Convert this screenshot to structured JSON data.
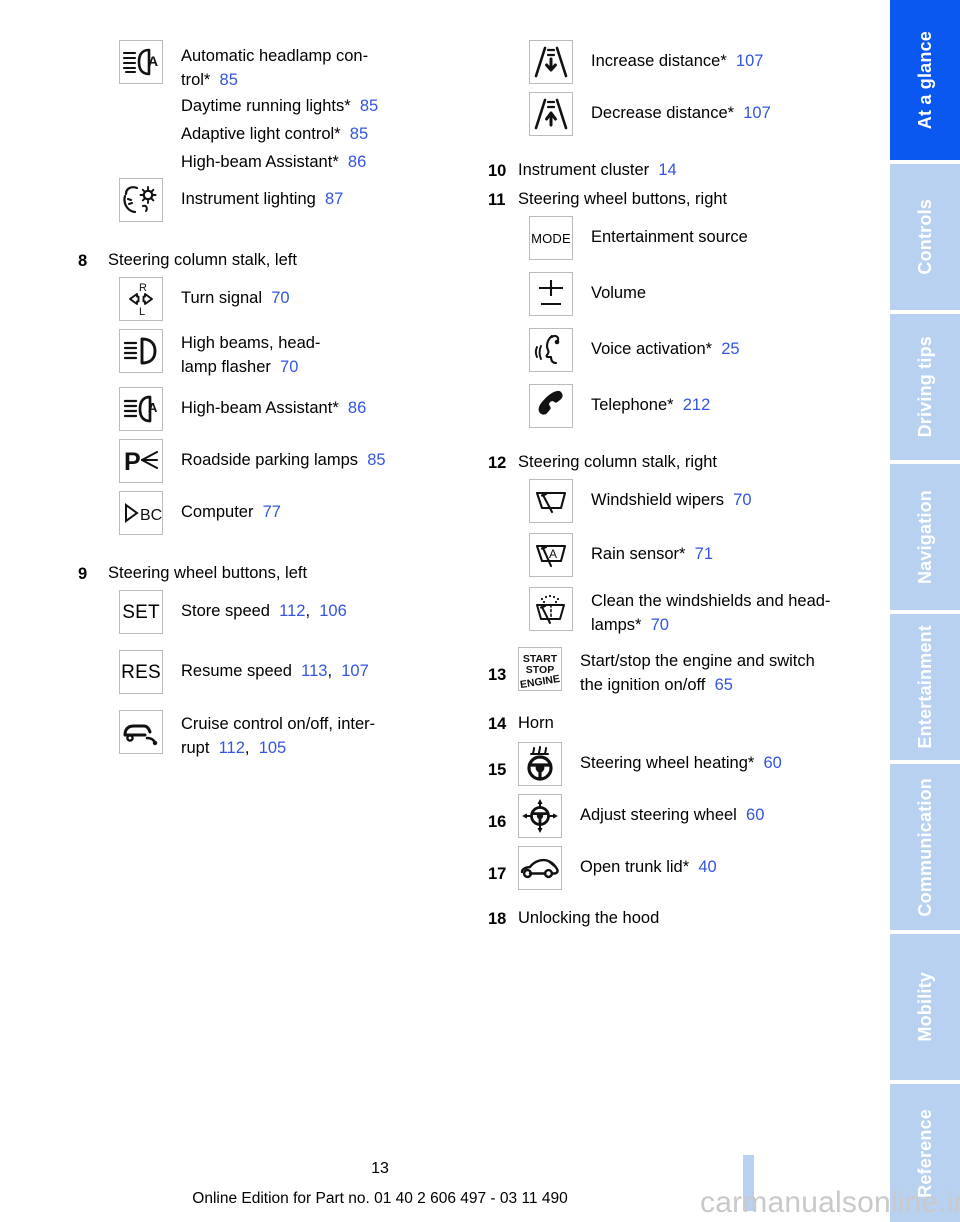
{
  "document": {
    "page_number": "13",
    "footer": "Online Edition for Part no. 01 40 2 606 497 - 03 11 490",
    "watermark": "carmanualsonline.info"
  },
  "colors": {
    "tab_active": "#0b58f0",
    "tab_inactive": "#b9d1f0",
    "page_reference": "#3355e0",
    "icon_border": "#b9bcbe"
  },
  "rail": {
    "tabs": [
      {
        "label": "At a glance",
        "active": true
      },
      {
        "label": "Controls",
        "active": false
      },
      {
        "label": "Driving tips",
        "active": false
      },
      {
        "label": "Navigation",
        "active": false
      },
      {
        "label": "Entertainment",
        "active": false
      },
      {
        "label": "Communication",
        "active": false
      },
      {
        "label": "Mobility",
        "active": false
      },
      {
        "label": "Reference",
        "active": false
      }
    ]
  },
  "left_column": {
    "lighting_group": {
      "rows": [
        {
          "icon": "automatic-headlamp-control-icon",
          "icon_text": "",
          "label": "Automatic headlamp con-\ntrol*",
          "label_line1": "Automatic headlamp con-",
          "label_line2": "trol*",
          "page": "85"
        },
        {
          "icon": "none",
          "label": "Daytime running lights*",
          "page": "85"
        },
        {
          "icon": "none",
          "label": "Adaptive light control*",
          "page": "85"
        },
        {
          "icon": "none",
          "label": "High-beam Assistant*",
          "page": "86"
        },
        {
          "icon": "instrument-lighting-icon",
          "label": "Instrument lighting",
          "page": "87"
        }
      ]
    },
    "item8": {
      "number": "8",
      "title": "Steering column stalk, left",
      "rows": [
        {
          "icon": "turn-signal-icon",
          "label": "Turn signal",
          "page": "70"
        },
        {
          "icon": "high-beams-headlamp-flasher-icon",
          "label_line1": "High beams, head-",
          "label_line2": "lamp flasher",
          "page": "70"
        },
        {
          "icon": "high-beam-assistant-icon",
          "label": "High-beam Assistant*",
          "page": "86"
        },
        {
          "icon": "roadside-parking-lamps-icon",
          "label": "Roadside parking lamps",
          "page": "85"
        },
        {
          "icon": "computer-bc-icon",
          "label": "Computer",
          "page": "77"
        }
      ]
    },
    "item9": {
      "number": "9",
      "title": "Steering wheel buttons, left",
      "rows": [
        {
          "icon": "set-button-icon",
          "icon_text": "SET",
          "label": "Store speed",
          "page": "112",
          "page2": "106"
        },
        {
          "icon": "res-button-icon",
          "icon_text": "RES",
          "label": "Resume speed",
          "page": "113",
          "page2": "107"
        },
        {
          "icon": "cruise-control-icon",
          "label_line1": "Cruise control on/off, inter-",
          "label_line2": "rupt",
          "page": "112",
          "page2": "105"
        }
      ]
    }
  },
  "right_column": {
    "distance_group": {
      "rows": [
        {
          "icon": "increase-distance-icon",
          "label": "Increase distance*",
          "page": "107"
        },
        {
          "icon": "decrease-distance-icon",
          "label": "Decrease distance*",
          "page": "107"
        }
      ]
    },
    "item10": {
      "number": "10",
      "title": "Instrument cluster",
      "page": "14"
    },
    "item11": {
      "number": "11",
      "title": "Steering wheel buttons, right",
      "rows": [
        {
          "icon": "mode-button-icon",
          "icon_text": "MODE",
          "label": "Entertainment source",
          "page": ""
        },
        {
          "icon": "volume-icon",
          "label": "Volume",
          "page": ""
        },
        {
          "icon": "voice-activation-icon",
          "label": "Voice activation*",
          "page": "25"
        },
        {
          "icon": "telephone-icon",
          "label": "Telephone*",
          "page": "212"
        }
      ]
    },
    "item12": {
      "number": "12",
      "title": "Steering column stalk, right",
      "rows": [
        {
          "icon": "windshield-wipers-icon",
          "label": "Windshield wipers",
          "page": "70"
        },
        {
          "icon": "rain-sensor-icon",
          "label": "Rain sensor*",
          "page": "71"
        },
        {
          "icon": "clean-windshields-headlamps-icon",
          "label_line1": "Clean the windshields and head-",
          "label_line2": "lamps*",
          "page": "70"
        }
      ]
    },
    "item13": {
      "number": "13",
      "icon": "start-stop-engine-icon",
      "icon_text_1": "START",
      "icon_text_2": "STOP",
      "icon_text_3": "ENGINE",
      "label_line1": "Start/stop the engine and switch",
      "label_line2": "the ignition on/off",
      "page": "65"
    },
    "item14": {
      "number": "14",
      "title": "Horn"
    },
    "item15": {
      "number": "15",
      "icon": "steering-wheel-heating-icon",
      "label": "Steering wheel heating*",
      "page": "60"
    },
    "item16": {
      "number": "16",
      "icon": "adjust-steering-wheel-icon",
      "label": "Adjust steering wheel",
      "page": "60"
    },
    "item17": {
      "number": "17",
      "icon": "open-trunk-lid-icon",
      "label": "Open trunk lid*",
      "page": "40"
    },
    "item18": {
      "number": "18",
      "title": "Unlocking the hood"
    }
  }
}
